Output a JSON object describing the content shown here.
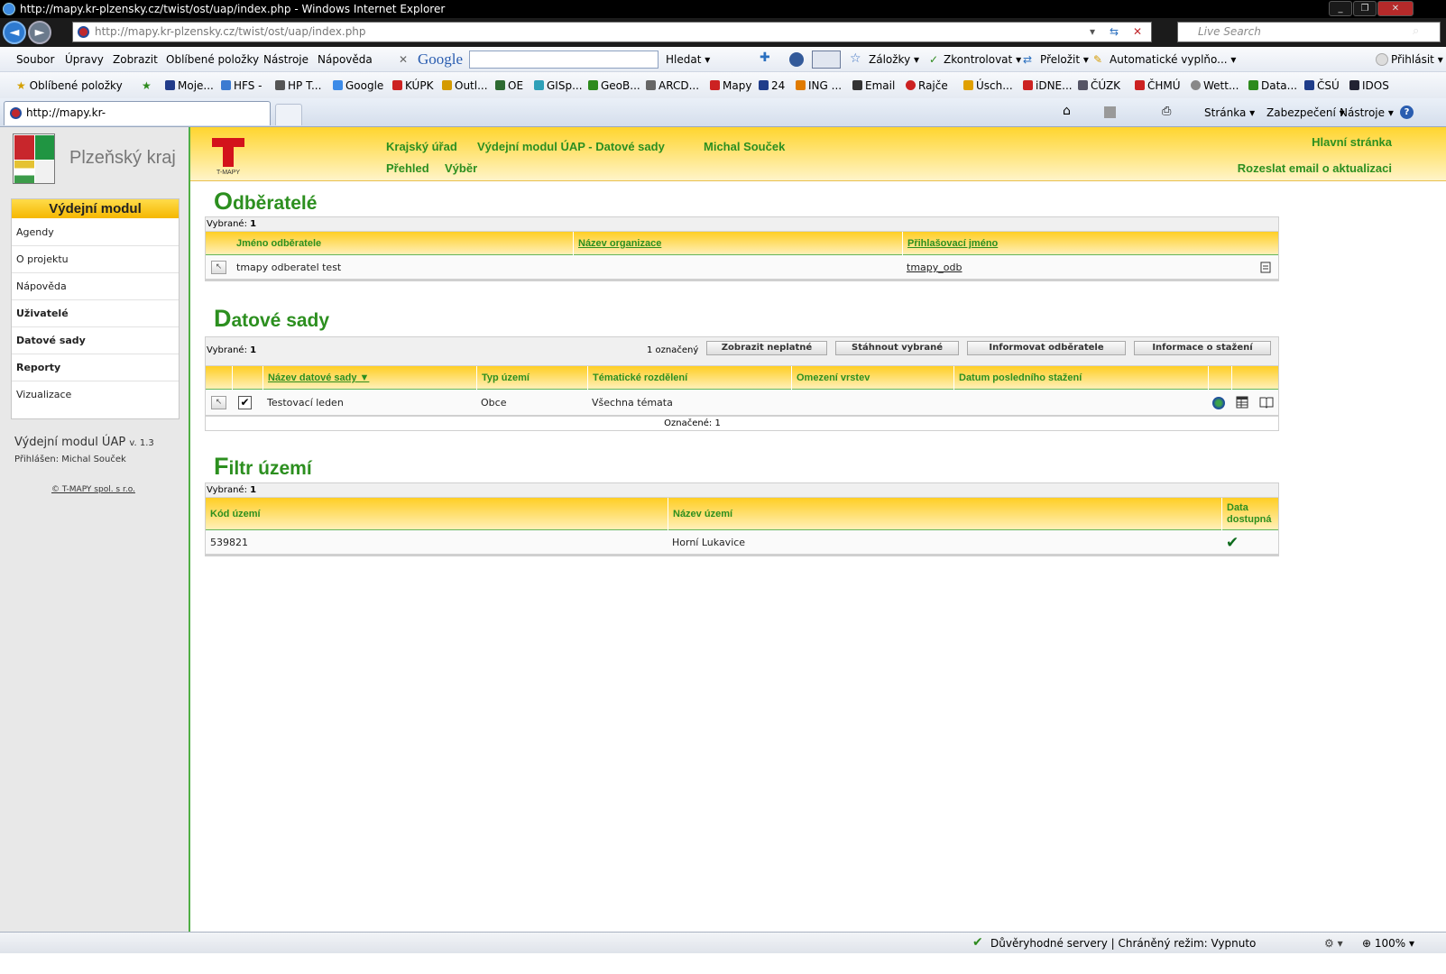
{
  "window": {
    "title": "http://mapy.kr-plzensky.cz/twist/ost/uap/index.php - Windows Internet Explorer"
  },
  "address": {
    "url_domain": "http://mapy.kr-plzensky.cz",
    "url_path": "/twist/ost/uap/index.php",
    "search_placeholder": "Live Search"
  },
  "menu": [
    "Soubor",
    "Úpravy",
    "Zobrazit",
    "Oblíbené položky",
    "Nástroje",
    "Nápověda"
  ],
  "toolbar": {
    "google": "Google",
    "hledat": "Hledat",
    "zalozky": "Záložky",
    "zkontrolovat": "Zkontrolovat",
    "prelozit": "Přeložit",
    "automaticke": "Automatické vyplňo...",
    "prihlasit": "Přihlásit"
  },
  "favorites": {
    "label": "Oblíbené položky",
    "items": [
      "Moje...",
      "HFS -",
      "HP T...",
      "Google",
      "KÚPK",
      "Outl...",
      "OE",
      "GISp...",
      "GeoB...",
      "ARCD...",
      "Mapy",
      "24",
      "ING ...",
      "Email",
      "Rajče",
      "Úsch...",
      "iDNE...",
      "ČÚZK",
      "ČHMÚ",
      "Wett...",
      "Data...",
      "ČSÚ",
      "IDOS"
    ]
  },
  "tab": {
    "title": "http://mapy.kr-plzensky.cz/twist/ost/uap/index...."
  },
  "tabtools": {
    "stranka": "Stránka",
    "zabezpeceni": "Zabezpečení",
    "nastroje": "Nástroje"
  },
  "sidebar": {
    "region": "Plzeňský kraj",
    "module_title": "Výdejní modul",
    "items": [
      {
        "label": "Agendy",
        "bold": false
      },
      {
        "label": "O projektu",
        "bold": false
      },
      {
        "label": "Nápověda",
        "bold": false
      },
      {
        "label": "Uživatelé",
        "bold": true
      },
      {
        "label": "Datové sady",
        "bold": true
      },
      {
        "label": "Reporty",
        "bold": true
      },
      {
        "label": "Vizualizace",
        "bold": false
      }
    ],
    "version_name": "Výdejní modul ÚAP",
    "version": "v. 1.3",
    "logged": "Přihlášen: Michal Souček",
    "copyright": "© T-MAPY spol. s r.o."
  },
  "header": {
    "office": "Krajský úřad",
    "module": "Výdejní modul ÚAP - Datové sady",
    "user": "Michal Souček",
    "nav1": "Přehled",
    "nav2": "Výběr",
    "home": "Hlavní stránka",
    "email": "Rozeslat email o aktualizaci",
    "logo_text": "T-MAPY"
  },
  "odberatele": {
    "title_first": "O",
    "title_rest": "dběratelé",
    "selected": "Vybrané:",
    "selected_count": "1",
    "columns": [
      "Jméno odběratele",
      "Název organizace",
      "Přihlašovací jméno"
    ],
    "rows": [
      {
        "name": "tmapy odberatel test",
        "org": "",
        "login": "tmapy_odb"
      }
    ]
  },
  "sady": {
    "title_first": "D",
    "title_rest": "atové sady",
    "selected": "Vybrané:",
    "selected_count": "1",
    "marked_count": "1 označený",
    "buttons": [
      "Zobrazit neplatné",
      "Stáhnout vybrané",
      "Informovat odběratele",
      "Informace o stažení"
    ],
    "columns": [
      "Název datové sady ▼",
      "Typ území",
      "Tématické rozdělení",
      "Omezení vrstev",
      "Datum posledního stažení"
    ],
    "rows": [
      {
        "name": "Testovací leden",
        "type": "Obce",
        "theme": "Všechna témata",
        "limit": "",
        "date": ""
      }
    ],
    "footer": "Označené:",
    "footer_count": "1"
  },
  "filtr": {
    "title_first": "F",
    "title_rest": "iltr území",
    "selected": "Vybrané:",
    "selected_count": "1",
    "columns": [
      "Kód území",
      "Název území",
      "Data dostupná"
    ],
    "rows": [
      {
        "code": "539821",
        "name": "Horní Lukavice",
        "available": "✔"
      }
    ]
  },
  "status": {
    "text": "Důvěryhodné servery | Chráněný režim: Vypnuto",
    "zoom": "100%"
  }
}
